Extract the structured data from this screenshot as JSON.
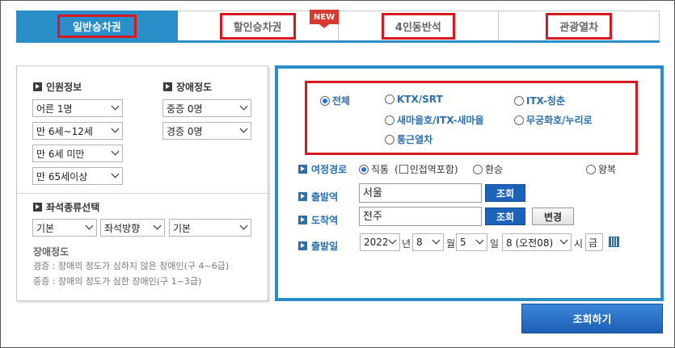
{
  "tabs": [
    {
      "label": "일반승차권",
      "active": true
    },
    {
      "label": "할인승차권",
      "badge": "NEW"
    },
    {
      "label": "4인동반석"
    },
    {
      "label": "관광열차"
    }
  ],
  "passenger": {
    "title": "인원정보",
    "adult": "어른 1명",
    "child": "만 6세~12세",
    "infant": "만 6세 미만",
    "senior": "만 65세이상"
  },
  "disability": {
    "title": "장애정도",
    "severe": "중증 0명",
    "mild": "경증 0명"
  },
  "seat": {
    "title": "좌석종류선택",
    "type": "기본",
    "direction": "좌석방향",
    "position": "기본"
  },
  "disability_note": {
    "title": "장애정도",
    "mild": "경증 : 장애의 정도가 심하지 않은 장애인(구 4~6급)",
    "severe": "중증 : 장애의 정도가 심한 장애인(구 1~3급)"
  },
  "train_types": {
    "all": "전체",
    "ktx": "KTX/SRT",
    "itx_cheongchun": "ITX-청춘",
    "saemaeul": "새마을호/ITX-새마을",
    "mugunghwa": "무궁화호/누리로",
    "commuter": "통근열차",
    "selected": "all"
  },
  "route": {
    "label": "여정경로",
    "direct": "직통",
    "nearby": "인접역포함",
    "transfer": "환승",
    "roundtrip": "왕복"
  },
  "departure": {
    "label": "출발역",
    "value": "서울",
    "button": "조회"
  },
  "arrival": {
    "label": "도착역",
    "value": "전주",
    "button": "조회",
    "swap": "변경"
  },
  "date": {
    "label": "출발일",
    "year": "2022",
    "year_unit": "년",
    "month": "8",
    "month_unit": "월",
    "day": "5",
    "day_unit": "일",
    "hour": "8 (오전08)",
    "hour_unit": "시",
    "weekday": "금"
  },
  "search_button": "조회하기",
  "colors": {
    "accent": "#2a8ec9",
    "highlight": "#d6191f",
    "link": "#2a6fae"
  }
}
